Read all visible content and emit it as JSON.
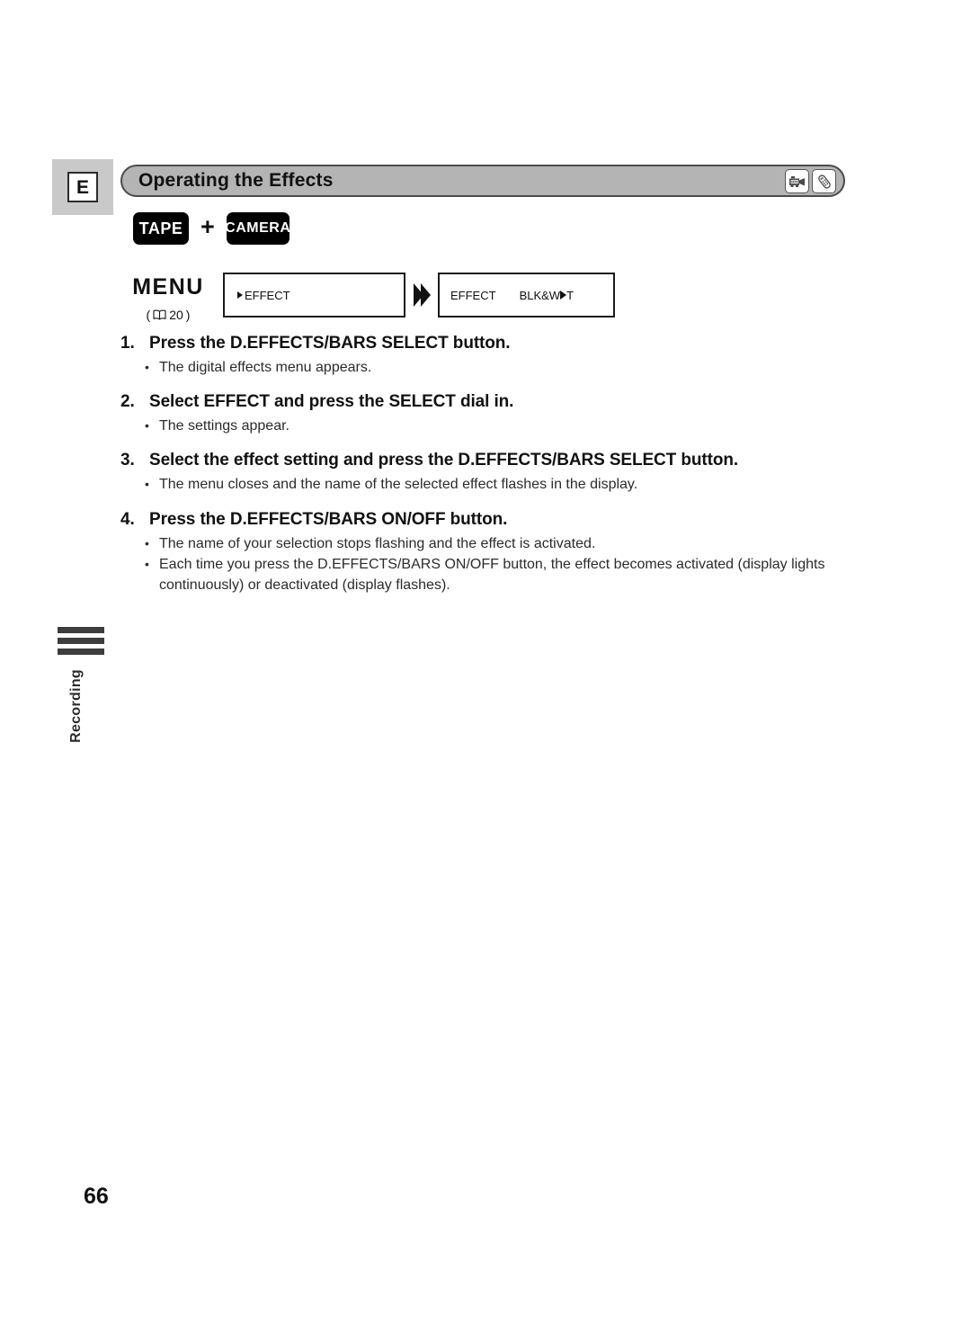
{
  "page": {
    "language_marker": "E",
    "number": "66"
  },
  "header": {
    "title": "Operating the Effects",
    "icons": [
      {
        "name": "camcorder-icon",
        "label": "camcorder"
      },
      {
        "name": "remote-control-icon",
        "label": "remote control"
      }
    ]
  },
  "modes": {
    "first": "TAPE",
    "plus": "+",
    "second": "CAMERA"
  },
  "menu_diagram": {
    "label": "MENU",
    "reference_open": "(",
    "reference_page": "20",
    "reference_close": ")",
    "screens": [
      {
        "name": "menu-screen-effect",
        "cursor": "▶",
        "text": "EFFECT"
      },
      {
        "name": "menu-screen-effect-setting",
        "left_text": "EFFECT",
        "right_text_a": "BLK&W",
        "right_text_b": "T"
      }
    ]
  },
  "steps": [
    {
      "number": "1.",
      "text": "Press the D.EFFECTS/BARS SELECT button.",
      "bullets": [
        "The digital effects menu appears."
      ]
    },
    {
      "number": "2.",
      "text": "Select EFFECT and press the SELECT dial in.",
      "bullets": [
        "The settings appear."
      ]
    },
    {
      "number": "3.",
      "text": "Select the effect setting and press the D.EFFECTS/BARS SELECT button.",
      "bullets": [
        "The menu closes and the name of the selected effect flashes in the display."
      ]
    },
    {
      "number": "4.",
      "text": "Press the D.EFFECTS/BARS ON/OFF button.",
      "bullets": [
        "The name of your selection stops flashing and the effect is activated.",
        "Each time you press the D.EFFECTS/BARS ON/OFF button, the effect becomes activated (display lights continuously) or deactivated (display flashes)."
      ]
    }
  ],
  "side_tab": {
    "label": "Recording"
  },
  "bullet_char": "•"
}
